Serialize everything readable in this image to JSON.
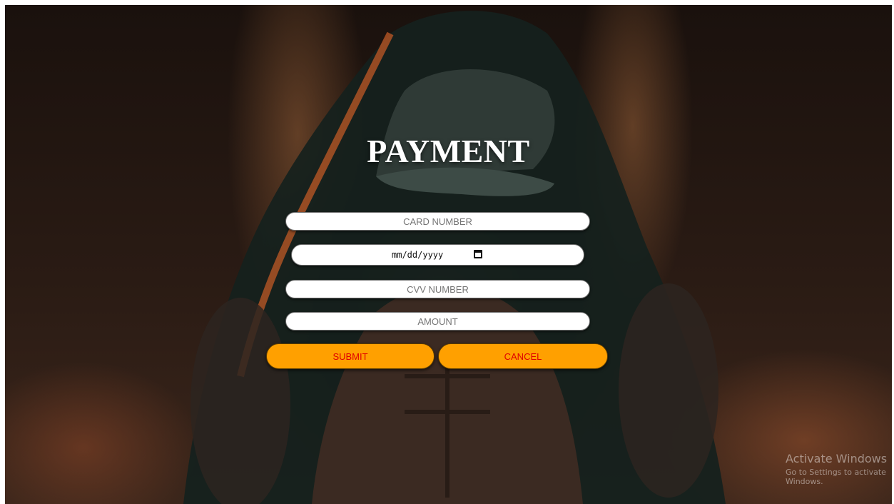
{
  "page": {
    "title": "PAYMENT"
  },
  "form": {
    "card_number_placeholder": "CARD NUMBER",
    "expiry_date_placeholder": "mm/dd/yyyy",
    "cvv_placeholder": "CVV NUMBER",
    "amount_placeholder": "AMOUNT",
    "submit_label": "SUBMIT",
    "cancel_label": "CANCEL"
  },
  "watermark": {
    "line1": "Activate Windows",
    "line2": "Go to Settings to activate Windows."
  },
  "colors": {
    "button_fill": "#ffa000",
    "button_text": "#e00000",
    "title_text": "#ffffff"
  },
  "icons": {
    "date_picker": "calendar-icon"
  }
}
